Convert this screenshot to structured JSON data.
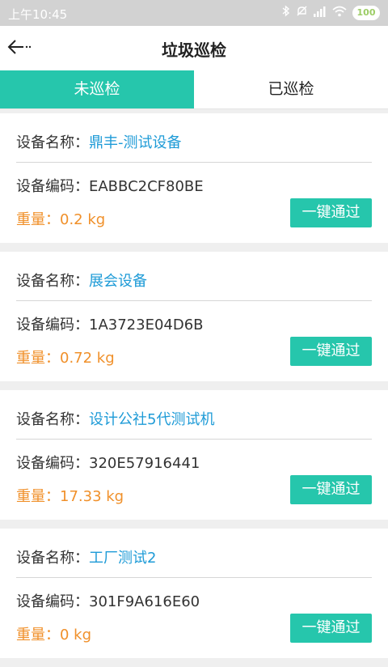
{
  "status_bar": {
    "time": "上午10:45",
    "battery": "100",
    "signal_text": ".ııl"
  },
  "header": {
    "title": "垃圾巡检"
  },
  "tabs": [
    {
      "label": "未巡检",
      "active": true
    },
    {
      "label": "已巡检",
      "active": false
    }
  ],
  "labels": {
    "name": "设备名称：",
    "code": "设备编码：",
    "weight": "重量："
  },
  "items": [
    {
      "name": "鼎丰-测试设备",
      "code": "EABBC2CF80BE",
      "weight": "0.2 kg",
      "button": "一键通过"
    },
    {
      "name": "展会设备",
      "code": "1A3723E04D6B",
      "weight": "0.72 kg",
      "button": "一键通过"
    },
    {
      "name": "设计公社5代测试机",
      "code": "320E57916441",
      "weight": "17.33 kg",
      "button": "一键通过"
    },
    {
      "name": "工厂测试2",
      "code": "301F9A616E60",
      "weight": "0 kg",
      "button": "一键通过"
    }
  ],
  "colors": {
    "accent": "#26c6ac",
    "name_value": "#1e9bd7",
    "weight": "#f0902a"
  }
}
